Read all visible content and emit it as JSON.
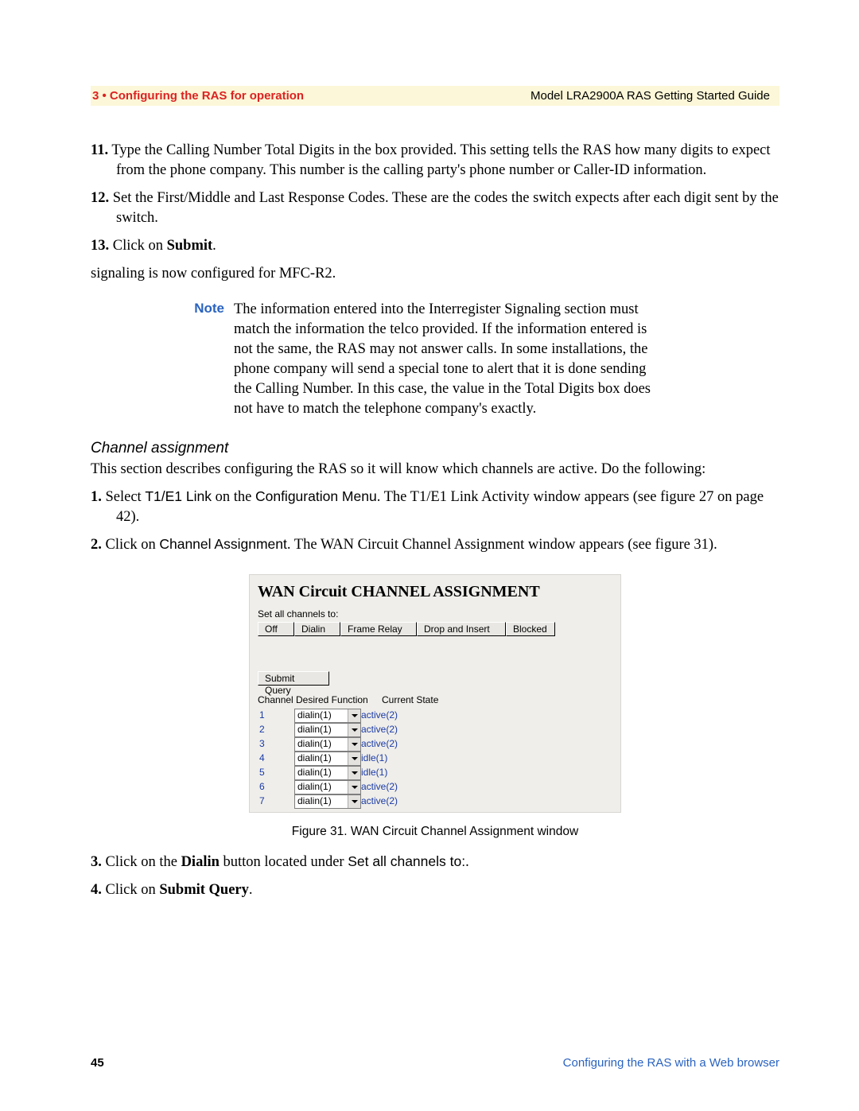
{
  "header": {
    "left": "3 • Configuring the RAS for operation",
    "right": "Model LRA2900A RAS Getting Started Guide"
  },
  "steps_a": [
    {
      "num": "11.",
      "text": "Type the Calling Number Total Digits in the box provided. This setting tells the RAS how many digits to expect from the phone company. This number is the calling party's phone number or Caller-ID information."
    },
    {
      "num": "12.",
      "text": "Set the First/Middle and Last Response Codes. These are the codes the switch expects after each digit sent by the switch."
    }
  ],
  "step13": {
    "num": "13.",
    "pre": "Click on ",
    "bold": "Submit",
    "post": "."
  },
  "signaling_line": "signaling is now configured for MFC-R2.",
  "note": {
    "label": "Note",
    "text": "The information entered into the Interregister Signaling section must match the information the telco provided. If the information entered is not the same, the RAS may not answer calls. In some installations, the phone company will send a special tone to alert that it is done sending the Calling Number. In this case, the value in the Total Digits box does not have to match the telephone company's exactly."
  },
  "channel_section": {
    "heading": "Channel assignment",
    "intro": "This section describes configuring the RAS so it will know which channels are active. Do the following:"
  },
  "steps_b": {
    "s1": {
      "num": "1.",
      "pre": "Select ",
      "sans1": "T1/E1 Link",
      "mid1": " on the ",
      "sans2": "Configuration Menu",
      "post": ". The T1/E1 Link Activity window appears (see figure 27 on page 42)."
    },
    "s2": {
      "num": "2.",
      "pre": "Click on ",
      "sans": "Channel Assignment",
      "post": ". The WAN Circuit Channel Assignment window appears (see figure 31)."
    },
    "s3": {
      "num": "3.",
      "pre": "Click on the ",
      "bold": "Dialin",
      "mid": " button located under ",
      "sans": "Set all channels to:",
      "post": "."
    },
    "s4": {
      "num": "4.",
      "pre": "Click on ",
      "bold": "Submit Query",
      "post": "."
    }
  },
  "figure": {
    "title": "WAN Circuit CHANNEL ASSIGNMENT",
    "set_all_label": "Set all channels to:",
    "buttons": {
      "off": "Off",
      "dialin": "Dialin",
      "frame_relay": "Frame Relay",
      "drop_insert": "Drop and Insert",
      "blocked": "Blocked"
    },
    "submit": "Submit Query",
    "col_channel": "Channel",
    "col_func": "Desired Function",
    "col_state": "Current State",
    "rows": [
      {
        "idx": "1",
        "func": "dialin(1)",
        "state": "active(2)"
      },
      {
        "idx": "2",
        "func": "dialin(1)",
        "state": "active(2)"
      },
      {
        "idx": "3",
        "func": "dialin(1)",
        "state": "active(2)"
      },
      {
        "idx": "4",
        "func": "dialin(1)",
        "state": "idle(1)"
      },
      {
        "idx": "5",
        "func": "dialin(1)",
        "state": "idle(1)"
      },
      {
        "idx": "6",
        "func": "dialin(1)",
        "state": "active(2)"
      },
      {
        "idx": "7",
        "func": "dialin(1)",
        "state": "active(2)"
      }
    ],
    "caption": "Figure 31. WAN Circuit Channel Assignment window"
  },
  "footer": {
    "page": "45",
    "text": "Configuring the RAS with a Web browser"
  }
}
